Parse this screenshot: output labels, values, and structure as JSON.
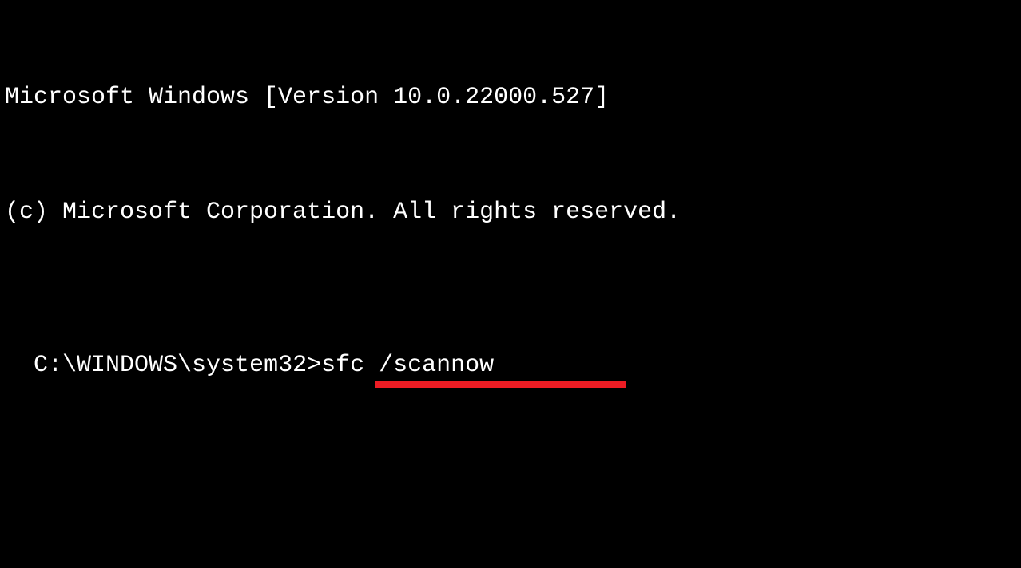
{
  "terminal": {
    "version_line": "Microsoft Windows [Version 10.0.22000.527]",
    "copyright_line": "(c) Microsoft Corporation. All rights reserved.",
    "blank_line": "",
    "prompt": "C:\\WINDOWS\\system32>",
    "command": "sfc /scannow"
  },
  "annotation": {
    "type": "underline",
    "color": "#ed1c24"
  }
}
